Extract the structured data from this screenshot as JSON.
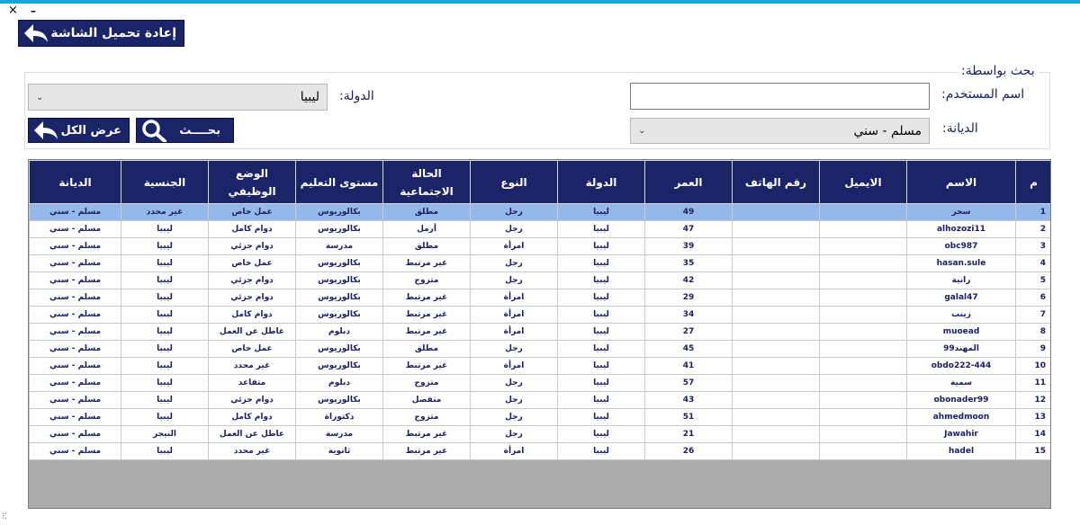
{
  "window": {
    "close_glyph": "×",
    "minimize_glyph": "–"
  },
  "toolbar": {
    "reload_label": "إعادة تحميل الشاشة"
  },
  "search": {
    "legend": "بحث بواسطة:",
    "username_label": "اسم المستخدم:",
    "username_value": "",
    "country_label": "الدولة:",
    "country_value": "ليبيا",
    "religion_label": "الديانة:",
    "religion_value": "مسلم - سني",
    "search_label": "بحــــث",
    "show_all_label": "عرض الكل"
  },
  "icons": {
    "reload": "back-arrow-icon",
    "show_all": "back-arrow-icon",
    "search": "magnifier-icon",
    "chevron": "chevron-down-icon"
  },
  "colors": {
    "header_bg": "#1a2466",
    "selected_row": "#95b8ec",
    "accent_bar": "#1aa3d8"
  },
  "table": {
    "columns": [
      "م",
      "الاسم",
      "الايميل",
      "رقم الهاتف",
      "العمر",
      "الدولة",
      "النوع",
      "الحالة الاجتماعية",
      "مستوى التعليم",
      "الوضع الوظيفي",
      "الجنسية",
      "الديانة"
    ],
    "rows": [
      [
        "1",
        "سحر",
        "",
        "",
        "49",
        "ليبيا",
        "رجل",
        "مطلق",
        "بكالوريوس",
        "عمل خاص",
        "غير محدد",
        "مسلم - سني"
      ],
      [
        "2",
        "alhozozi11",
        "",
        "",
        "47",
        "ليبيا",
        "رجل",
        "أرمل",
        "بكالوريوس",
        "دوام كامل",
        "ليبيا",
        "مسلم - سني"
      ],
      [
        "3",
        "obc987",
        "",
        "",
        "39",
        "ليبيا",
        "امرأة",
        "مطلق",
        "مدرسة",
        "دوام جزئي",
        "ليبيا",
        "مسلم - سني"
      ],
      [
        "4",
        "hasan.sule",
        "",
        "",
        "35",
        "ليبيا",
        "رجل",
        "غير مرتبط",
        "بكالوريوس",
        "عمل خاص",
        "ليبيا",
        "مسلم - سني"
      ],
      [
        "5",
        "رانية",
        "",
        "",
        "42",
        "ليبيا",
        "رجل",
        "متزوج",
        "بكالوريوس",
        "دوام جزئي",
        "ليبيا",
        "مسلم - سني"
      ],
      [
        "6",
        "galal47",
        "",
        "",
        "29",
        "ليبيا",
        "امرأة",
        "غير مرتبط",
        "بكالوريوس",
        "دوام جزئي",
        "ليبيا",
        "مسلم - سني"
      ],
      [
        "7",
        "زينب",
        "",
        "",
        "34",
        "ليبيا",
        "امرأة",
        "غير مرتبط",
        "بكالوريوس",
        "دوام كامل",
        "ليبيا",
        "مسلم - سني"
      ],
      [
        "8",
        "muoead",
        "",
        "",
        "27",
        "ليبيا",
        "امرأة",
        "غير مرتبط",
        "دبلوم",
        "عاطل عن العمل",
        "ليبيا",
        "مسلم - سني"
      ],
      [
        "9",
        "المهند99",
        "",
        "",
        "45",
        "ليبيا",
        "رجل",
        "مطلق",
        "بكالوريوس",
        "عمل خاص",
        "ليبيا",
        "مسلم - سني"
      ],
      [
        "10",
        "obdo222-444",
        "",
        "",
        "41",
        "ليبيا",
        "امرأة",
        "غير مرتبط",
        "بكالوريوس",
        "غير محدد",
        "ليبيا",
        "مسلم - سني"
      ],
      [
        "11",
        "سمية",
        "",
        "",
        "57",
        "ليبيا",
        "رجل",
        "متزوج",
        "دبلوم",
        "متقاعد",
        "ليبيا",
        "مسلم - سني"
      ],
      [
        "12",
        "obonader99",
        "",
        "",
        "43",
        "ليبيا",
        "رجل",
        "منفصل",
        "بكالوريوس",
        "دوام جزئي",
        "ليبيا",
        "مسلم - سني"
      ],
      [
        "13",
        "ahmedmoon",
        "",
        "",
        "51",
        "ليبيا",
        "رجل",
        "متزوج",
        "دكتوراة",
        "دوام كامل",
        "ليبيا",
        "مسلم - سني"
      ],
      [
        "14",
        "Jawahir",
        "",
        "",
        "21",
        "ليبيا",
        "رجل",
        "غير مرتبط",
        "مدرسة",
        "عاطل عن العمل",
        "النيجر",
        "مسلم - سني"
      ],
      [
        "15",
        "hadel",
        "",
        "",
        "26",
        "ليبيا",
        "امرأة",
        "غير مرتبط",
        "ثانوية",
        "غير محدد",
        "ليبيا",
        "مسلم - سني"
      ]
    ]
  }
}
